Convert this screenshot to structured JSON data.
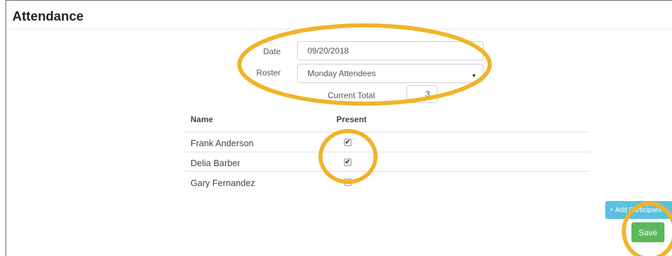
{
  "page": {
    "title": "Attendance"
  },
  "form": {
    "date_label": "Date",
    "date_value": "09/20/2018",
    "roster_label": "Roster",
    "roster_value": "Monday Attendees",
    "current_total_label": "Current Total",
    "current_total_value": "3"
  },
  "table": {
    "headers": [
      "Name",
      "Present"
    ],
    "rows": [
      {
        "name": "Frank Anderson",
        "present": true
      },
      {
        "name": "Delia Barber",
        "present": true
      },
      {
        "name": "Gary Fernandez",
        "present": true
      }
    ]
  },
  "actions": {
    "add_participant_label": "+ Add Participant",
    "save_label": "Save"
  },
  "annotations": {
    "highlight_color": "#f0b429"
  }
}
